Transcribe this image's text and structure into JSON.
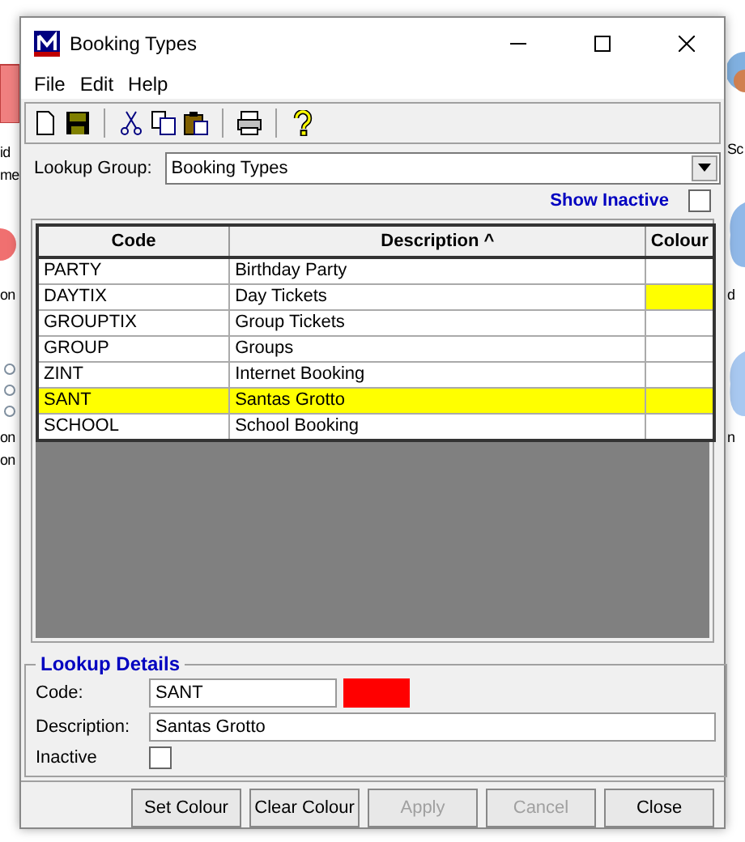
{
  "background": {
    "left_labels": [
      "id",
      "me",
      "on",
      "on",
      "on"
    ],
    "right_labels": [
      "Sc",
      "d",
      "n"
    ]
  },
  "window": {
    "title": "Booking Types"
  },
  "menu": [
    "File",
    "Edit",
    "Help"
  ],
  "lookup_group": {
    "label": "Lookup Group:",
    "value": "Booking Types"
  },
  "show_inactive": {
    "label": "Show Inactive",
    "checked": false
  },
  "table": {
    "columns": [
      {
        "label": "Code"
      },
      {
        "label": "Description ^"
      },
      {
        "label": "Colour"
      }
    ],
    "rows": [
      {
        "code": "PARTY",
        "description": "Birthday Party",
        "selected": false
      },
      {
        "code": "DAYTIX",
        "description": "Day Tickets",
        "color": "#ffff00",
        "selected": false
      },
      {
        "code": "GROUPTIX",
        "description": "Group Tickets",
        "selected": false
      },
      {
        "code": "GROUP",
        "description": "Groups",
        "selected": false
      },
      {
        "code": "ZINT",
        "description": "Internet Booking",
        "selected": false
      },
      {
        "code": "SANT",
        "description": "Santas Grotto",
        "selected": true
      },
      {
        "code": "SCHOOL",
        "description": "School Booking",
        "selected": false
      }
    ]
  },
  "details": {
    "title": "Lookup Details",
    "code_label": "Code:",
    "code": "SANT",
    "color": "#ff0000",
    "description_label": "Description:",
    "description": "Santas Grotto",
    "inactive_label": "Inactive",
    "inactive": false
  },
  "buttons": [
    {
      "label": "Set Colour",
      "disabled": false
    },
    {
      "label": "Clear Colour",
      "disabled": false
    },
    {
      "label": "Apply",
      "disabled": true
    },
    {
      "label": "Cancel",
      "disabled": true
    },
    {
      "label": "Close",
      "disabled": false
    }
  ]
}
